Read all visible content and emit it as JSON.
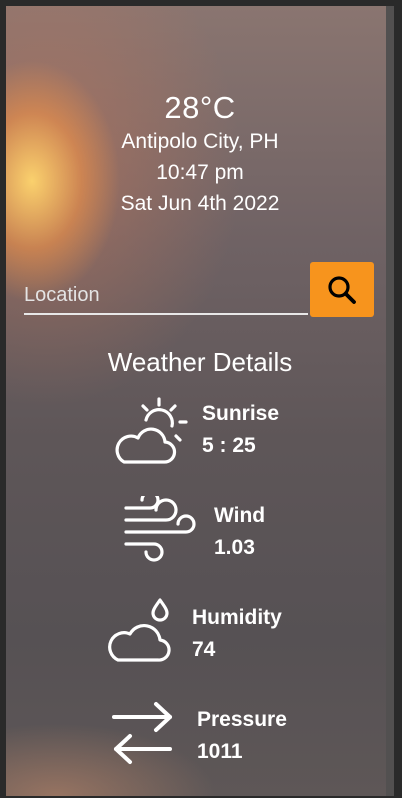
{
  "weather": {
    "temperature": "28°C",
    "city": "Antipolo City, PH",
    "time": "10:47 pm",
    "date": "Sat Jun 4th 2022"
  },
  "search": {
    "placeholder": "Location",
    "button_icon": "search-icon",
    "button_color": "#f7941d"
  },
  "details": {
    "title": "Weather Details",
    "items": [
      {
        "label": "Sunrise",
        "value": "5 : 25",
        "icon": "partly-cloudy-sun-icon"
      },
      {
        "label": "Wind",
        "value": "1.03",
        "icon": "wind-icon"
      },
      {
        "label": "Humidity",
        "value": "74",
        "icon": "cloud-droplet-icon"
      },
      {
        "label": "Pressure",
        "value": "1011",
        "icon": "arrows-left-right-icon"
      }
    ]
  }
}
